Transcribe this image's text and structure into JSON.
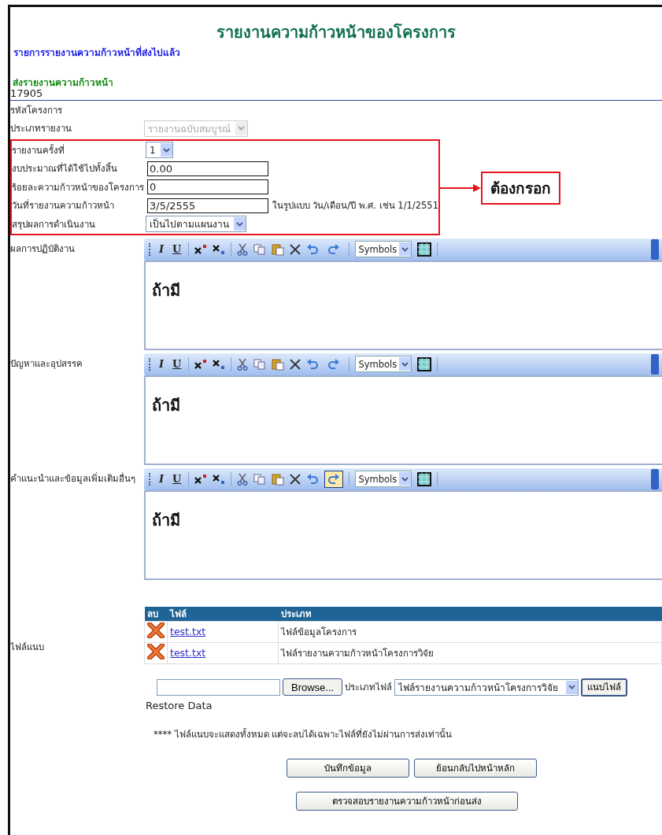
{
  "title": "รายงานความก้าวหน้าของโครงการ",
  "sent_reports_link": "รายการรายงานความก้าวหน้าที่ส่งไปแล้ว",
  "section_heading": "ส่งรายงานความก้าวหน้า",
  "project_id": "17905",
  "fields": [
    {
      "kind": "label",
      "label": "รหัสโครงการ"
    },
    {
      "kind": "select",
      "label": "ประเภทรายงาน",
      "value": "รายงานฉบับสมบูรณ์",
      "disabled": true
    }
  ],
  "required_fields": [
    {
      "kind": "select",
      "label": "รายงานครั้งที่",
      "value": "1",
      "disabled": false
    },
    {
      "kind": "input",
      "label": "งบประมาณที่ได้ใช้ไปทั้งสิ้น",
      "value": "0.00"
    },
    {
      "kind": "input",
      "label": "ร้อยละความก้าวหน้าของโครงการ",
      "value": "0"
    },
    {
      "kind": "input",
      "label": "วันที่รายงานความก้าวหน้า",
      "value": "3/5/2555",
      "hint": "ในรูปแบบ วัน/เดือน/ปี พ.ศ. เช่น 1/1/2551"
    },
    {
      "kind": "select",
      "label": "สรุปผลการดำเนินงาน",
      "value": "เป็นไปตามแผนงาน",
      "disabled": false
    }
  ],
  "required_callout": "ต้องกรอก",
  "editors": [
    {
      "label": "ผลการปฏิบัติงาน",
      "italic": "I",
      "underline": "U",
      "symbols": "Symbols",
      "content": "ถ้ามี",
      "redo_highlighted": false
    },
    {
      "label": "ปัญหาและอุปสรรค",
      "italic": "I",
      "underline": "U",
      "symbols": "Symbols",
      "content": "ถ้ามี",
      "redo_highlighted": false
    },
    {
      "label": "คำแนะนำและข้อมูลเพิ่มเติมอื่นๆ",
      "italic": "I",
      "underline": "U",
      "symbols": "Symbols",
      "content": "ถ้ามี",
      "redo_highlighted": true
    }
  ],
  "attachments": {
    "label": "ไฟล์แนบ",
    "columns": [
      "ลบ",
      "ไฟล์",
      "ประเภท"
    ],
    "rows": [
      {
        "file": "test.txt",
        "type": "ไฟล์ข้อมูลโครงการ"
      },
      {
        "file": "test.txt",
        "type": "ไฟล์รายงานความก้าวหน้าโครงการวิจัย"
      }
    ],
    "browse_button": "Browse...",
    "file_type_label": "ประเภทไฟล์",
    "file_type_value": "ไฟล์รายงานความก้าวหน้าโครงการวิจัย",
    "attach_button": "แนบไฟล์",
    "restore": "Restore Data",
    "note": "**** ไฟล์แนบจะแสดงทั้งหมด แต่จะลบได้เฉพาะไฟล์ที่ยังไม่ผ่านการส่งเท่านั้น"
  },
  "buttons": [
    "บันทึกข้อมูล",
    "ย้อนกลับไปหน้าหลัก"
  ],
  "check_button": "ตรวจสอบรายงานความก้าวหน้าก่อนส่ง"
}
